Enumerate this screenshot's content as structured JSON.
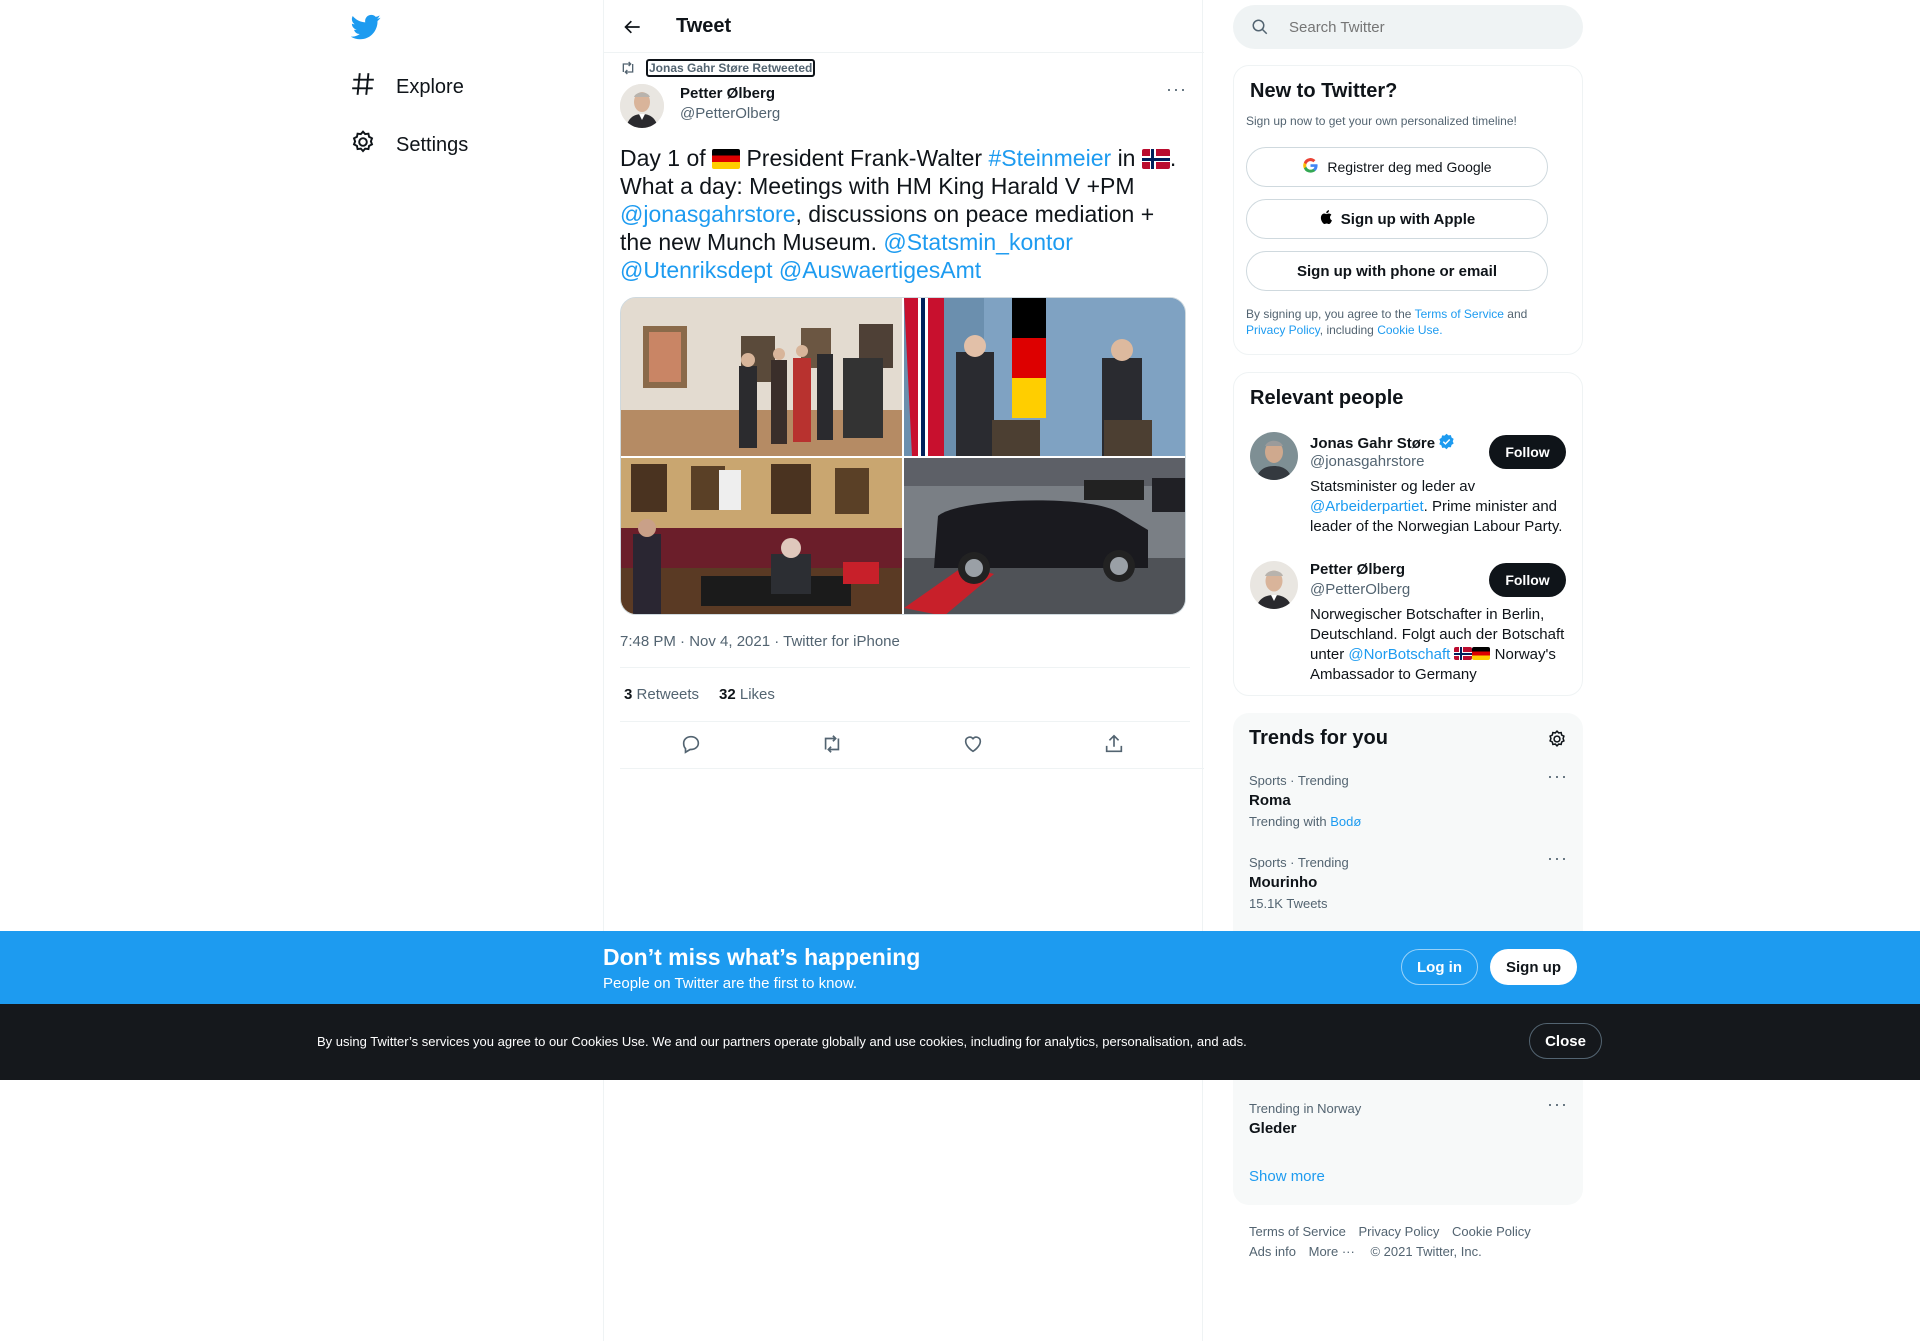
{
  "colors": {
    "accent": "#1d9bf0",
    "dark": "#0f1419",
    "muted": "#536471",
    "signup_bar": "#1d9bf0",
    "cookie_bar": "#15181c"
  },
  "nav": {
    "logo_icon": "twitter-bird-icon",
    "items": [
      {
        "icon": "hashtag-icon",
        "label": "Explore"
      },
      {
        "icon": "gear-icon",
        "label": "Settings"
      }
    ]
  },
  "header": {
    "title": "Tweet"
  },
  "tweet": {
    "retweeted_by": "Jonas Gahr Støre Retweeted",
    "author_name": "Petter Ølberg",
    "author_handle": "@PetterOlberg",
    "text": {
      "p1": "Day 1 of",
      "p2": "President Frank-Walter",
      "hashtag": "#Steinmeier",
      "p3": "in",
      "p4": ".",
      "p5": "What a day: Meetings with HM King Harald V +PM",
      "mention1": "@jonasgahrstore",
      "p6": ", discussions on peace mediation + the new Munch Museum.",
      "mention2": "@Statsmin_kontor",
      "mention3": "@Utenriksdept",
      "mention4": "@AuswaertigesAmt"
    },
    "timestamp": "7:48 PM · Nov 4, 2021 · Twitter for iPhone",
    "retweets_count": "3",
    "retweets_label": "Retweets",
    "likes_count": "32",
    "likes_label": "Likes"
  },
  "search": {
    "placeholder": "Search Twitter"
  },
  "new_to_twitter": {
    "title": "New to Twitter?",
    "subtitle": "Sign up now to get your own personalized timeline!",
    "google_label": "Registrer deg med Google",
    "apple_label": "Sign up with Apple",
    "phone_label": "Sign up with phone or email",
    "legal": {
      "p1": "By signing up, you agree to the",
      "tos": "Terms of Service",
      "and": "and",
      "privacy": "Privacy Policy",
      "including": ", including",
      "cookie": "Cookie Use."
    }
  },
  "relevant_people": {
    "title": "Relevant people",
    "people": [
      {
        "name": "Jonas Gahr Støre",
        "handle": "@jonasgahrstore",
        "follow": "Follow",
        "bio1": "Statsminister og leder av",
        "bio_link": "@Arbeiderpartiet",
        "bio2": ". Prime minister and leader of the Norwegian Labour Party.",
        "verified": true
      },
      {
        "name": "Petter Ølberg",
        "handle": "@PetterOlberg",
        "follow": "Follow",
        "bio1": "Norwegischer Botschafter in Berlin, Deutschland. Folgt auch der Botschaft unter",
        "bio_link": "@NorBotschaft",
        "bio2": "Norway's Ambassador to Germany"
      }
    ]
  },
  "trends": {
    "title": "Trends for you",
    "items": [
      {
        "meta": "Sports · Trending",
        "name": "Roma",
        "sub_prefix": "Trending with",
        "sub_link": "Bodø"
      },
      {
        "meta": "Sports · Trending",
        "name": "Mourinho",
        "sub": "15.1K Tweets"
      },
      {
        "meta": "Trending in Norway",
        "name": "Gleder"
      }
    ],
    "show_more": "Show more"
  },
  "footer": {
    "links": [
      "Terms of Service",
      "Privacy Policy",
      "Cookie Policy",
      "Ads info",
      "More ···"
    ],
    "copyright": "© 2021 Twitter, Inc."
  },
  "signup_bar": {
    "title": "Don’t miss what’s happening",
    "subtitle": "People on Twitter are the first to know.",
    "login": "Log in",
    "signup": "Sign up"
  },
  "cookie_bar": {
    "text": "By using Twitter’s services you agree to our Cookies Use. We and our partners operate globally and use cookies, including for analytics, personalisation, and ads.",
    "close": "Close"
  }
}
